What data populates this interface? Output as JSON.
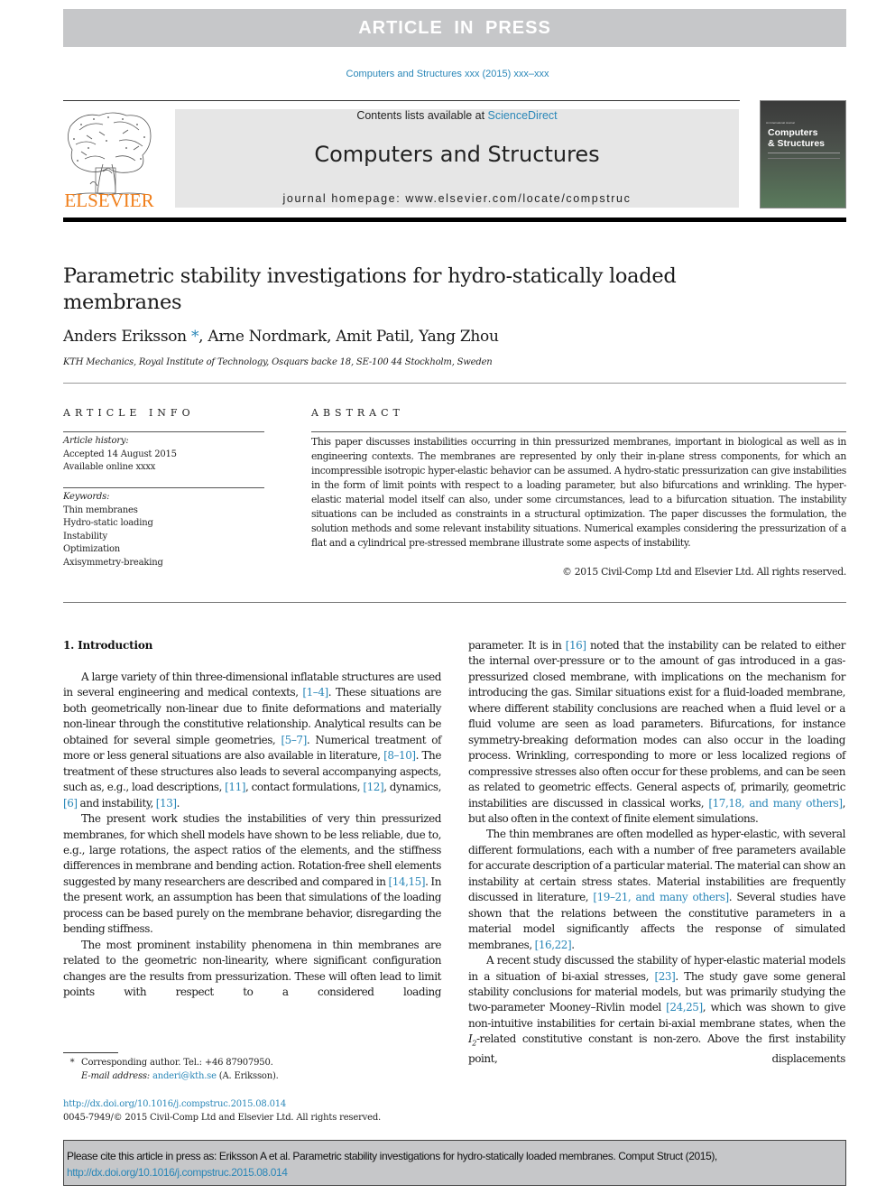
{
  "banner": {
    "text": "ARTICLE IN PRESS"
  },
  "journal_ref": "Computers and Structures xxx (2015) xxx–xxx",
  "masthead": {
    "publisher": "ELSEVIER",
    "contents_prefix": "Contents lists available at ",
    "contents_link": "ScienceDirect",
    "journal_name": "Computers and Structures",
    "homepage_prefix": "journal homepage: ",
    "homepage_url": "www.elsevier.com/locate/compstruc",
    "cover_small": "An International Journal",
    "cover_title_line1": "Computers",
    "cover_title_line2": "& Structures"
  },
  "article": {
    "title": "Parametric stability investigations for hydro-statically loaded membranes",
    "authors": [
      {
        "name": "Anders Eriksson",
        "corresponding": true
      },
      {
        "name": "Arne Nordmark"
      },
      {
        "name": "Amit Patil"
      },
      {
        "name": "Yang Zhou"
      }
    ],
    "author_first": "Anders Eriksson",
    "author_star": "*",
    "author_rest": ", Arne Nordmark, Amit Patil, Yang Zhou",
    "affiliation": "KTH Mechanics, Royal Institute of Technology, Osquars backe 18, SE-100 44 Stockholm, Sweden"
  },
  "article_info": {
    "heading": "ARTICLE INFO",
    "history_label": "Article history:",
    "accepted": "Accepted 14 August 2015",
    "available": "Available online xxxx",
    "keywords_label": "Keywords:",
    "keywords": [
      "Thin membranes",
      "Hydro-static loading",
      "Instability",
      "Optimization",
      "Axisymmetry-breaking"
    ]
  },
  "abstract": {
    "heading": "ABSTRACT",
    "text": "This paper discusses instabilities occurring in thin pressurized membranes, important in biological as well as in engineering contexts. The membranes are represented by only their in-plane stress components, for which an incompressible isotropic hyper-elastic behavior can be assumed. A hydro-static pressurization can give instabilities in the form of limit points with respect to a loading parameter, but also bifurcations and wrinkling. The hyper-elastic material model itself can also, under some circumstances, lead to a bifurcation situation. The instability situations can be included as constraints in a structural optimization. The paper discusses the formulation, the solution methods and some relevant instability situations. Numerical examples considering the pressurization of a flat and a cylindrical pre-stressed membrane illustrate some aspects of instability.",
    "copyright": "© 2015 Civil-Comp Ltd and Elsevier Ltd. All rights reserved."
  },
  "intro": {
    "heading": "1. Introduction",
    "p1": [
      "A large variety of thin three-dimensional inflatable structures are used in several engineering and medical contexts, ",
      "[1–4]",
      ". These situations are both geometrically non-linear due to finite deformations and materially non-linear through the constitutive relationship. Analytical results can be obtained for several simple geometries, ",
      "[5–7]",
      ". Numerical treatment of more or less general situations are also available in literature, ",
      "[8–10]",
      ". The treatment of these structures also leads to several accompanying aspects, such as, e.g., load descriptions, ",
      "[11]",
      ", contact formulations, ",
      "[12]",
      ", dynamics, ",
      "[6]",
      " and instability, ",
      "[13]",
      "."
    ],
    "p2": [
      "The present work studies the instabilities of very thin pressurized membranes, for which shell models have shown to be less reliable, due to, e.g., large rotations, the aspect ratios of the elements, and the stiffness differences in membrane and bending action. Rotation-free shell elements suggested by many researchers are described and compared in ",
      "[14,15]",
      ". In the present work, an assumption has been that simulations of the loading process can be based purely on the membrane behavior, disregarding the bending stiffness."
    ],
    "p3": "The most prominent instability phenomena in thin membranes are related to the geometric non-linearity, where significant configuration changes are the results from pressurization. These will often lead to limit points with respect to a considered loading",
    "r1": [
      "parameter. It is in ",
      "[16]",
      " noted that the instability can be related to either the internal over-pressure or to the amount of gas introduced in a gas-pressurized closed membrane, with implications on the mechanism for introducing the gas. Similar situations exist for a fluid-loaded membrane, where different stability conclusions are reached when a fluid level or a fluid volume are seen as load parameters. Bifurcations, for instance symmetry-breaking deformation modes can also occur in the loading process. Wrinkling, corresponding to more or less localized regions of compressive stresses also often occur for these problems, and can be seen as related to geometric effects. General aspects of, primarily, geometric instabilities are discussed in classical works, ",
      "[17,18, and many others]",
      ", but also often in the context of finite element simulations."
    ],
    "r2": [
      "The thin membranes are often modelled as hyper-elastic, with several different formulations, each with a number of free parameters available for accurate description of a particular material. The material can show an instability at certain stress states. Material instabilities are frequently discussed in literature, ",
      "[19–21, and many others]",
      ". Several studies have shown that the relations between the constitutive parameters in a material model significantly affects the response of simulated membranes, ",
      "[16,22]",
      "."
    ],
    "r3": [
      "A recent study discussed the stability of hyper-elastic material models in a situation of bi-axial stresses, ",
      "[23]",
      ". The study gave some general stability conclusions for material models, but was primarily studying the two-parameter Mooney–Rivlin model ",
      "[24,25]",
      ", which was shown to give non-intuitive instabilities for certain bi-axial membrane states, when the ",
      "I2",
      "-related constitutive constant is non-zero. Above the first instability point, displacements"
    ]
  },
  "footnote": {
    "star": "*",
    "corresponding": "Corresponding author. Tel.: +46 87907950.",
    "email_label": "E-mail address:",
    "email": "anderi@kth.se",
    "email_suffix": " (A. Eriksson)."
  },
  "doi": {
    "url": "http://dx.doi.org/10.1016/j.compstruc.2015.08.014",
    "issn_line": "0045-7949/© 2015 Civil-Comp Ltd and Elsevier Ltd. All rights reserved."
  },
  "cite_box": {
    "text": "Please cite this article in press as: Eriksson A et al. Parametric stability investigations for hydro-statically loaded membranes. Comput Struct (2015), ",
    "link": "http://dx.doi.org/10.1016/j.compstruc.2015.08.014"
  },
  "colors": {
    "link": "#2a87b8",
    "elsevier_orange": "#f07e1a",
    "banner_gray": "#c6c7c9"
  }
}
